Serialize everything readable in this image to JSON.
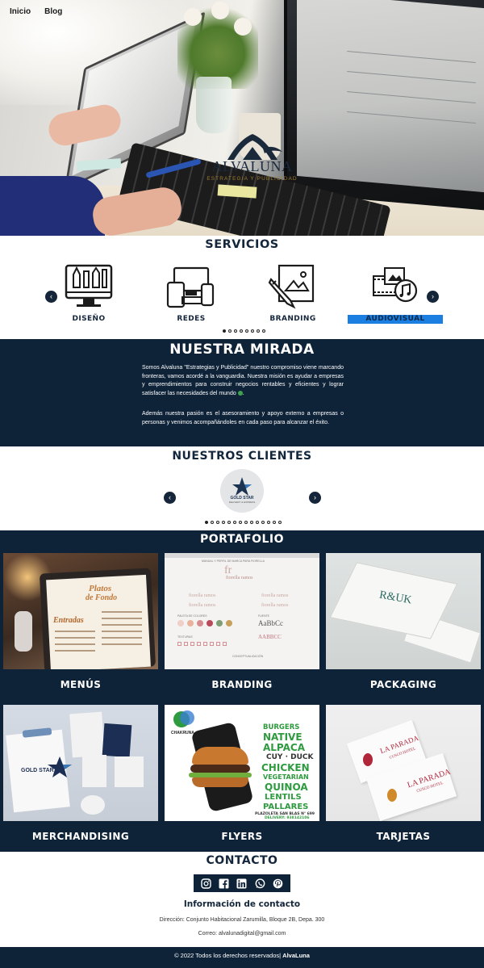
{
  "nav": {
    "items": [
      "Inicio",
      "Blog"
    ]
  },
  "hero": {
    "brand": "ALVALUNA",
    "tagline": "ESTRATEGIA Y PUBLICIDAD"
  },
  "servicios": {
    "title": "SERVICIOS",
    "items": [
      "DISEÑO",
      "REDES",
      "BRANDING",
      "AUDIOVISUAL"
    ],
    "active_index": 3,
    "prev": "‹",
    "next": "›",
    "page_count": 8,
    "active_page": 0
  },
  "mirada": {
    "title": "NUESTRA MIRADA",
    "p1": "Somos Alvaluna \"Estrategias y Publicidad\" nuestro compromiso viene marcando fronteras, vamos acordé a la vanguardia. Nuestra misión es ayudar a empresas y emprendimientos para construir negocios rentables y eficientes y lograr satisfacer las necesidades del mundo",
    "p2": "Además nuestra pasión es el asesoramiento y apoyo externo a empresas o personas y venimos acompañándoles en cada paso para alcanzar el éxito."
  },
  "clientes": {
    "title": "NUESTROS CLIENTES",
    "client_name": "GOLD STAR",
    "client_sub": "DELIVERY & EXPRESS",
    "prev": "‹",
    "next": "›",
    "page_count": 14,
    "active_page": 0
  },
  "portafolio": {
    "title": "PORTAFOLIO",
    "items": [
      "MENÚS",
      "BRANDING",
      "PACKAGING",
      "MERCHANDISING",
      "FLYERS",
      "TARJETAS"
    ],
    "menu_words": {
      "top": "Platos",
      "top2": "de Fondo",
      "left": "Entradas"
    },
    "branding_words": {
      "name": "fiorella ramos",
      "top": "MANUAL Y PERFIL DE MARCA PARA FIORELLA",
      "colors_label": "PALETA DE COLORES",
      "font_label": "FUENTE",
      "sample": "AaBbCc",
      "sample2": "AABBCC",
      "texture_label": "TEXTURAS",
      "concept": "CONCEPTUALIZACIÓN"
    },
    "pack_word": "R&UK",
    "merch_word": "GOLD STAR",
    "flyer_words": {
      "brand": "CHAKRUNA",
      "lines": [
        "BURGERS",
        "NATIVE",
        "ALPACA",
        "CUY · DUCK",
        "CHICKEN",
        "VEGETARIAN",
        "QUINOA",
        "LENTILS",
        "PALLARES"
      ],
      "address": "PLAZOLETA SAN BLAS N° 699",
      "delivery": "DELIVERY: 938142106"
    },
    "tarj_words": {
      "name": "LA PARADA",
      "sub": "CUSCO HOTEL"
    },
    "colors": {
      "navy": "#0e2238",
      "brand_green": "#2d6a63",
      "flyer_green": "#2d9b3e"
    }
  },
  "contacto": {
    "title": "CONTACTO",
    "social": [
      "instagram-icon",
      "facebook-icon",
      "linkedin-icon",
      "whatsapp-icon",
      "pinterest-icon"
    ],
    "info_title": "Información de contacto",
    "address": "Dirección: Conjunto Habitacional Zarumilla, Bloque 2B, Depa. 300",
    "email": "Correo: alvalunadigital@gmail.com"
  },
  "footer": {
    "text": "© 2022 Todos los derechos reservados|",
    "brand": "AlvaLuna"
  },
  "theme": {
    "navy": "#0e2238",
    "accent_blue": "#1a7fe0"
  }
}
